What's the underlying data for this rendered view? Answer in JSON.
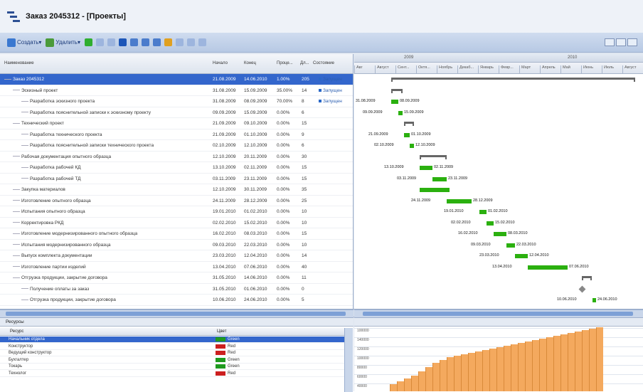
{
  "window": {
    "title": "Заказ 2045312 - [Проекты]"
  },
  "toolbar": {
    "create_label": "Создать",
    "delete_label": "Удалить"
  },
  "grid": {
    "columns": {
      "name": "Наименование",
      "start": "Начало",
      "end": "Конец",
      "pct": "Проце...",
      "dur": "Дл...",
      "state": "Состояние"
    },
    "rows": [
      {
        "name": "Заказ 2045312",
        "start": "21.08.2009",
        "end": "14.06.2010",
        "pct": "1.00%",
        "dur": "205",
        "state": "Запущен",
        "level": 0
      },
      {
        "name": "Эскизный проект",
        "start": "31.08.2009",
        "end": "15.09.2009",
        "pct": "35.00%",
        "dur": "14",
        "state": "Запущен",
        "level": 1
      },
      {
        "name": "Разработка эскизного проекта",
        "start": "31.08.2009",
        "end": "08.09.2009",
        "pct": "70.00%",
        "dur": "8",
        "state": "Запущен",
        "level": 2
      },
      {
        "name": "Разработка пояснительной записки к эскизному проекту",
        "start": "09.09.2009",
        "end": "15.09.2009",
        "pct": "0.00%",
        "dur": "6",
        "state": "",
        "level": 2
      },
      {
        "name": "Технический проект",
        "start": "21.09.2009",
        "end": "09.10.2009",
        "pct": "0.00%",
        "dur": "15",
        "state": "",
        "level": 1
      },
      {
        "name": "Разработка технического проекта",
        "start": "21.09.2009",
        "end": "01.10.2009",
        "pct": "0.00%",
        "dur": "9",
        "state": "",
        "level": 2
      },
      {
        "name": "Разработка пояснительной записки технического проекта",
        "start": "02.10.2009",
        "end": "12.10.2009",
        "pct": "0.00%",
        "dur": "6",
        "state": "",
        "level": 2
      },
      {
        "name": "Рабочая документация опытного образца",
        "start": "12.10.2009",
        "end": "20.11.2009",
        "pct": "0.00%",
        "dur": "30",
        "state": "",
        "level": 1
      },
      {
        "name": "Разработка рабочей КД",
        "start": "13.10.2009",
        "end": "02.11.2009",
        "pct": "0.00%",
        "dur": "15",
        "state": "",
        "level": 2
      },
      {
        "name": "Разработка рабочей ТД",
        "start": "03.11.2009",
        "end": "23.11.2009",
        "pct": "0.00%",
        "dur": "15",
        "state": "",
        "level": 2
      },
      {
        "name": "Закупка материалов",
        "start": "12.10.2009",
        "end": "30.11.2009",
        "pct": "0.00%",
        "dur": "35",
        "state": "",
        "level": 1
      },
      {
        "name": "Изготовление опытного образца",
        "start": "24.11.2009",
        "end": "28.12.2009",
        "pct": "0.00%",
        "dur": "25",
        "state": "",
        "level": 1
      },
      {
        "name": "Испытания опытного образца",
        "start": "19.01.2010",
        "end": "01.02.2010",
        "pct": "0.00%",
        "dur": "10",
        "state": "",
        "level": 1
      },
      {
        "name": "Корректировка РКД",
        "start": "02.02.2010",
        "end": "15.02.2010",
        "pct": "0.00%",
        "dur": "10",
        "state": "",
        "level": 1
      },
      {
        "name": "Изготовление модернизированного опытного образца",
        "start": "16.02.2010",
        "end": "08.03.2010",
        "pct": "0.00%",
        "dur": "15",
        "state": "",
        "level": 1
      },
      {
        "name": "Испытания модернизированного образца",
        "start": "09.03.2010",
        "end": "22.03.2010",
        "pct": "0.00%",
        "dur": "10",
        "state": "",
        "level": 1
      },
      {
        "name": "Выпуск комплекта документации",
        "start": "23.03.2010",
        "end": "12.04.2010",
        "pct": "0.00%",
        "dur": "14",
        "state": "",
        "level": 1
      },
      {
        "name": "Изготовление партии изделий",
        "start": "13.04.2010",
        "end": "07.06.2010",
        "pct": "0.00%",
        "dur": "40",
        "state": "",
        "level": 1
      },
      {
        "name": "Отгрузка продукции, закрытие договора",
        "start": "31.05.2010",
        "end": "14.06.2010",
        "pct": "0.00%",
        "dur": "11",
        "state": "",
        "level": 1
      },
      {
        "name": "Получение оплаты за заказ",
        "start": "31.05.2010",
        "end": "01.06.2010",
        "pct": "0.00%",
        "dur": "0",
        "state": "",
        "level": 2
      },
      {
        "name": "Отгрузка продукции, закрытие договора",
        "start": "10.06.2010",
        "end": "24.06.2010",
        "pct": "0.00%",
        "dur": "5",
        "state": "",
        "level": 2
      }
    ]
  },
  "gantt": {
    "years": [
      "2009",
      "2010"
    ],
    "months": [
      "Авг",
      "Август",
      "Сент...",
      "Октя...",
      "Ноябрь",
      "Декаб...",
      "Январь",
      "Февр...",
      "Март",
      "Апрель",
      "Май",
      "Июнь",
      "Июль",
      "Август"
    ],
    "labels": [
      {
        "left": "31.08.2009",
        "right": "08.09.2009"
      },
      {
        "left": "09.09.2009",
        "right": "15.09.2009"
      },
      {
        "left": "21.09.2009",
        "right": "01.10.2009"
      },
      {
        "left": "02.10.2009",
        "right": "12.10.2009"
      },
      {
        "left": "13.10.2009",
        "right": "02.11.2009"
      },
      {
        "left": "03.11.2009",
        "right": "23.11.2009"
      },
      {
        "left": "24.11.2009",
        "right": "28.12.2009"
      },
      {
        "left": "19.01.2010",
        "right": "01.02.2010"
      },
      {
        "left": "02.02.2010",
        "right": "15.02.2010"
      },
      {
        "left": "16.02.2010",
        "right": "08.03.2010"
      },
      {
        "left": "09.03.2010",
        "right": "22.03.2010"
      },
      {
        "left": "23.03.2010",
        "right": "12.04.2010"
      },
      {
        "left": "13.04.2010",
        "right": "07.06.2010"
      },
      {
        "left": "10.06.2010",
        "right": "24.06.2010"
      }
    ]
  },
  "resources": {
    "title": "Ресурсы",
    "columns": {
      "name": "Ресурс",
      "color": "Цвет"
    },
    "rows": [
      {
        "name": "Начальник отдела",
        "color": "Green",
        "hex": "#1f9a1f"
      },
      {
        "name": "Конструктор",
        "color": "Red",
        "hex": "#cc1f1f"
      },
      {
        "name": "Ведущий конструктор",
        "color": "Red",
        "hex": "#cc1f1f"
      },
      {
        "name": "Бухгалтер",
        "color": "Green",
        "hex": "#1f9a1f"
      },
      {
        "name": "Токарь",
        "color": "Green",
        "hex": "#1f9a1f"
      },
      {
        "name": "Технолог",
        "color": "Red",
        "hex": "#cc1f1f"
      }
    ]
  },
  "histogram": {
    "y_labels": [
      "100000",
      "140000",
      "120000",
      "100000",
      "80000",
      "60000",
      "40000"
    ]
  },
  "colors": {
    "accent": "#3366cc",
    "bar": "#2bb00f",
    "hist": "#f4a95e"
  }
}
